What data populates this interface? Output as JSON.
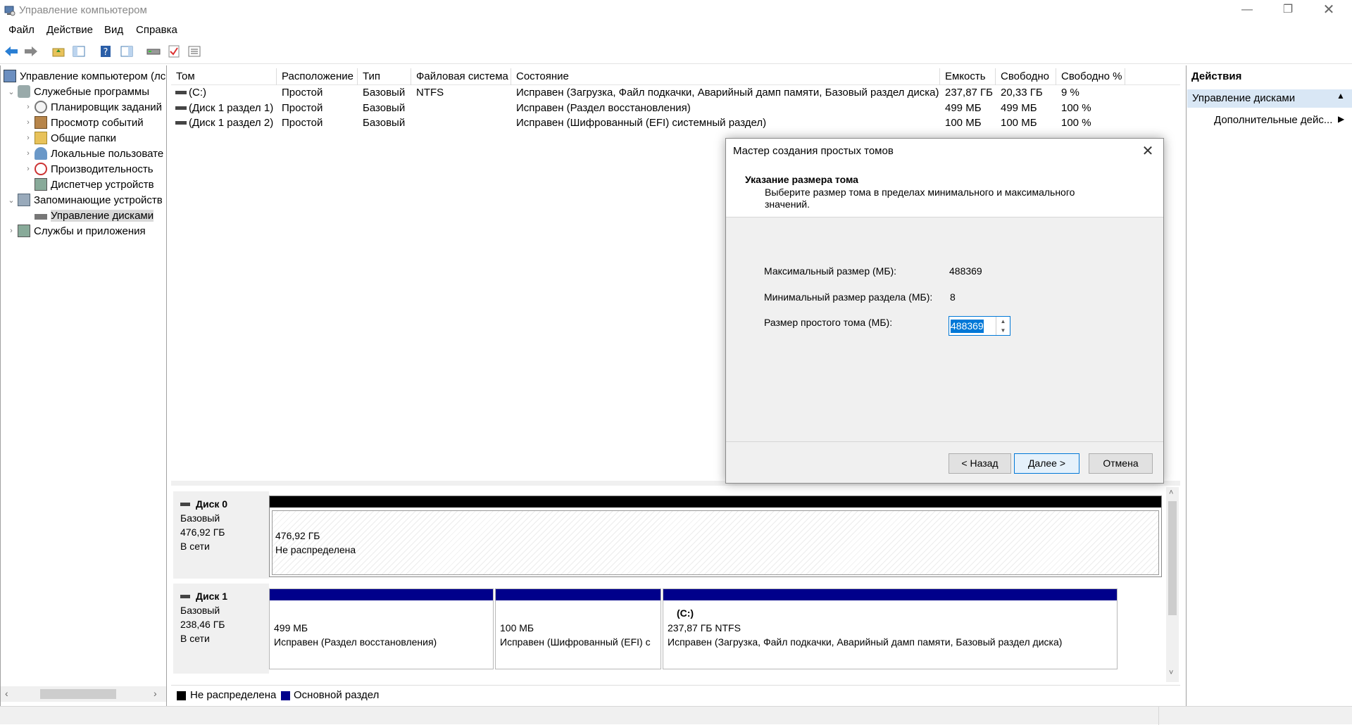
{
  "window": {
    "title": "Управление компьютером"
  },
  "menu": [
    "Файл",
    "Действие",
    "Вид",
    "Справка"
  ],
  "tree": [
    {
      "label": "Управление компьютером (лс",
      "level": 0
    },
    {
      "label": "Служебные программы",
      "level": 1
    },
    {
      "label": "Планировщик заданий",
      "level": 2
    },
    {
      "label": "Просмотр событий",
      "level": 2
    },
    {
      "label": "Общие папки",
      "level": 2
    },
    {
      "label": "Локальные пользовате",
      "level": 2
    },
    {
      "label": "Производительность",
      "level": 2
    },
    {
      "label": "Диспетчер устройств",
      "level": 2
    },
    {
      "label": "Запоминающие устройств",
      "level": 1
    },
    {
      "label": "Управление дисками",
      "level": 2
    },
    {
      "label": "Службы и приложения",
      "level": 1
    }
  ],
  "volumes": {
    "columns": [
      "Том",
      "Расположение",
      "Тип",
      "Файловая система",
      "Состояние",
      "Емкость",
      "Свободно",
      "Свободно %"
    ],
    "rows": [
      [
        "(C:)",
        "Простой",
        "Базовый",
        "NTFS",
        "Исправен (Загрузка, Файл подкачки, Аварийный дамп памяти, Базовый раздел диска)",
        "237,87 ГБ",
        "20,33 ГБ",
        "9 %"
      ],
      [
        "(Диск 1 раздел 1)",
        "Простой",
        "Базовый",
        "",
        "Исправен (Раздел восстановления)",
        "499 МБ",
        "499 МБ",
        "100 %"
      ],
      [
        "(Диск 1 раздел 2)",
        "Простой",
        "Базовый",
        "",
        "Исправен (Шифрованный (EFI) системный раздел)",
        "100 МБ",
        "100 МБ",
        "100 %"
      ]
    ]
  },
  "disks": {
    "disk0": {
      "name": "Диск 0",
      "type": "Базовый",
      "size": "476,92 ГБ",
      "status": "В сети",
      "part": {
        "size": "476,92 ГБ",
        "desc": "Не распределена"
      }
    },
    "disk1": {
      "name": "Диск 1",
      "type": "Базовый",
      "size": "238,46 ГБ",
      "status": "В сети",
      "parts": [
        {
          "name": "",
          "size": "499 МБ",
          "desc": "Исправен (Раздел восстановления)"
        },
        {
          "name": "",
          "size": "100 МБ",
          "desc": "Исправен (Шифрованный (EFI) с"
        },
        {
          "name": "(C:)",
          "size": "237,87 ГБ NTFS",
          "desc": "Исправен (Загрузка, Файл подкачки, Аварийный дамп памяти, Базовый раздел диска)"
        }
      ]
    }
  },
  "legend": [
    "Не распределена",
    "Основной раздел"
  ],
  "actions": {
    "title": "Действия",
    "section": "Управление дисками",
    "more": "Дополнительные дейс..."
  },
  "dialog": {
    "title": "Мастер создания простых томов",
    "heading": "Указание размера тома",
    "subtitle": "Выберите размер тома в пределах минимального и максимального значений.",
    "max_label": "Максимальный размер (МБ):",
    "max_value": "488369",
    "min_label": "Минимальный размер раздела (МБ):",
    "min_value": "8",
    "size_label": "Размер простого тома (МБ):",
    "size_value": "488369",
    "back": "< Назад",
    "next": "Далее >",
    "cancel": "Отмена"
  },
  "colors": {
    "unallocated": "#000000",
    "primary": "#00008b",
    "accent": "#0078d7"
  }
}
